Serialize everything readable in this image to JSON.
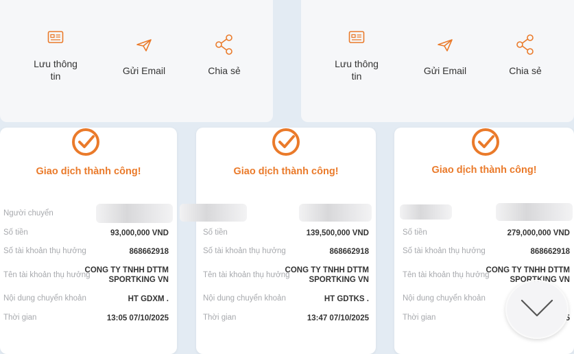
{
  "actions": {
    "save_label": "Lưu thông\ntin",
    "email_label": "Gửi Email",
    "share_label": "Chia sẻ"
  },
  "labels": {
    "success": "Giao dịch thành công!",
    "sender": "Người chuyển",
    "amount": "Số tiền",
    "account": "Số tài khoản thụ hưởng",
    "account_name": "Tên tài khoản thụ hưởng",
    "content": "Nội dung chuyển khoản",
    "time": "Thời gian"
  },
  "receipts": [
    {
      "amount": "93,000,000 VND",
      "account": "868662918",
      "account_name": "CONG TY TNHH DTTM\nSPORTKING VN",
      "content": "HT GDXM .",
      "time": "13:05 07/10/2025"
    },
    {
      "amount": "139,500,000 VND",
      "account": "868662918",
      "account_name": "CONG TY TNHH DTTM\nSPORTKING VN",
      "content": "HT GDTKS .",
      "time": "13:47 07/10/2025"
    },
    {
      "amount": "279,000,000 VND",
      "account": "868662918",
      "account_name": "CONG TY TNHH DTTM\nSPORTKING VN",
      "content": "",
      "time": "5"
    }
  ],
  "colors": {
    "accent": "#ea7a2a",
    "label_gray": "#a7a9ad"
  },
  "icons": [
    "id-card-icon",
    "send-icon",
    "share-icon",
    "check-circle-icon",
    "chevron-down-icon"
  ]
}
